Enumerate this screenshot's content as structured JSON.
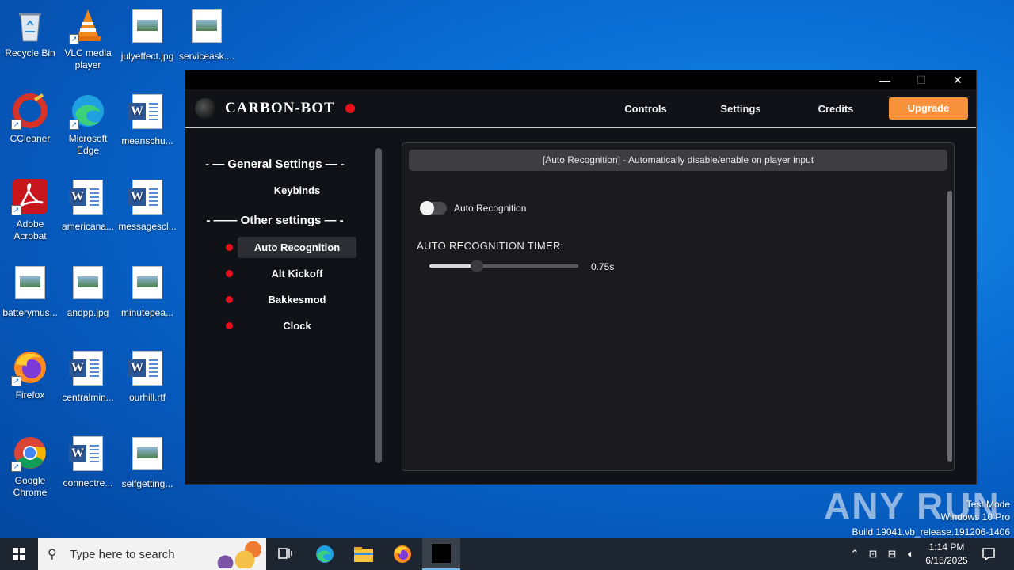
{
  "desktop": {
    "icons": [
      {
        "label": "Recycle Bin",
        "icon": "recycle-bin-icon"
      },
      {
        "label": "VLC media player",
        "icon": "vlc-icon"
      },
      {
        "label": "julyeffect.jpg",
        "icon": "image-file-icon"
      },
      {
        "label": "serviceask....",
        "icon": "image-file-icon"
      },
      {
        "label": "CCleaner",
        "icon": "ccleaner-icon"
      },
      {
        "label": "Microsoft Edge",
        "icon": "edge-icon"
      },
      {
        "label": "meanschu...",
        "icon": "word-doc-icon"
      },
      {
        "label": "Adobe Acrobat",
        "icon": "acrobat-icon"
      },
      {
        "label": "americana...",
        "icon": "word-doc-icon"
      },
      {
        "label": "messagescl...",
        "icon": "word-doc-icon"
      },
      {
        "label": "batterymus...",
        "icon": "image-file-icon"
      },
      {
        "label": "andpp.jpg",
        "icon": "image-file-icon"
      },
      {
        "label": "minutepea...",
        "icon": "image-file-icon"
      },
      {
        "label": "Firefox",
        "icon": "firefox-icon"
      },
      {
        "label": "centralmin...",
        "icon": "word-doc-icon"
      },
      {
        "label": "ourhill.rtf",
        "icon": "word-doc-icon"
      },
      {
        "label": "Google Chrome",
        "icon": "chrome-icon"
      },
      {
        "label": "connectre...",
        "icon": "word-doc-icon"
      },
      {
        "label": "selfgetting...",
        "icon": "image-file-icon"
      }
    ]
  },
  "window": {
    "controls": {
      "minimize": "—",
      "maximize": "☐",
      "close": "✕"
    },
    "brand": "CARBON-BOT",
    "status_color": "#e8101a",
    "nav": {
      "controls": "Controls",
      "settings": "Settings",
      "credits": "Credits",
      "upgrade": "Upgrade"
    },
    "accent": "#f7923a"
  },
  "sidebar": {
    "general_title": "- — General Settings — -",
    "keybinds": "Keybinds",
    "other_title": "- —— Other settings — -",
    "items": [
      {
        "label": "Auto Recognition",
        "active": true
      },
      {
        "label": "Alt Kickoff",
        "active": false
      },
      {
        "label": "Bakkesmod",
        "active": false
      },
      {
        "label": "Clock",
        "active": false
      }
    ]
  },
  "panel": {
    "header": "[Auto Recognition] - Automatically disable/enable on player input",
    "toggle_label": "Auto Recognition",
    "toggle_on": false,
    "timer_label": "AUTO RECOGNITION TIMER:",
    "timer_fraction": 0.32,
    "timer_value": "0.75s"
  },
  "watermark": {
    "logo": "ANY RUN",
    "mode": "Test Mode",
    "os": "Windows 10 Pro",
    "build": "Build 19041.vb_release.191206-1406"
  },
  "taskbar": {
    "search_placeholder": "Type here to search",
    "time": "1:14 PM",
    "date": "6/15/2025"
  }
}
